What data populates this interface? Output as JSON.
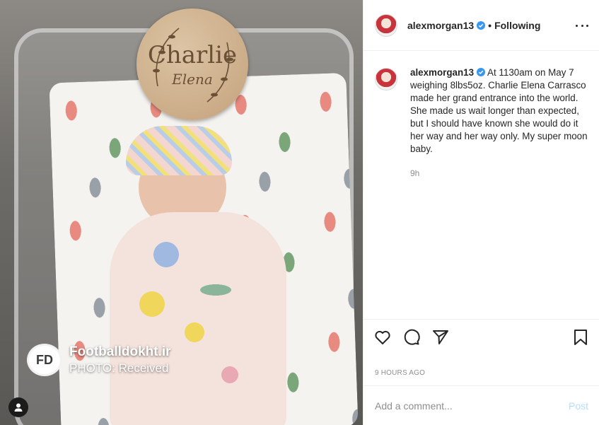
{
  "photo": {
    "sign_name": "Charlie",
    "sign_middle": "Elena",
    "watermark_logo": "FD",
    "watermark_brand": "Footballdokht.ir",
    "watermark_sub": "PHOTO: Received",
    "tag_icon": "user-tag-icon"
  },
  "header": {
    "username": "alexmorgan13",
    "verified_icon": "verified-badge-icon",
    "separator": "•",
    "follow_status": "Following",
    "more_icon": "more-options-icon"
  },
  "caption": {
    "username": "alexmorgan13",
    "text": " At 1130am on May 7 weighing 8lbs5oz. Charlie Elena Carrasco made her grand entrance into the world. She made us wait longer than expected, but I should have known she would do it her way and her way only. My super moon baby.",
    "time": "9h"
  },
  "actions": {
    "like_icon": "heart-icon",
    "comment_icon": "comment-icon",
    "share_icon": "send-icon",
    "save_icon": "bookmark-icon"
  },
  "post_time": "9 HOURS AGO",
  "comment": {
    "placeholder": "Add a comment...",
    "post_label": "Post"
  },
  "colors": {
    "accent_link": "#0095f6",
    "post_button_disabled": "#b2dffc",
    "secondary_text": "#8e8e8e"
  }
}
